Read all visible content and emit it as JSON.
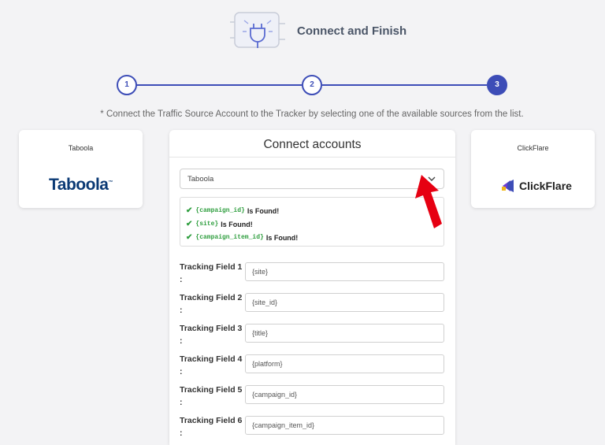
{
  "header": {
    "title": "Connect and Finish",
    "icon": "plug-icon"
  },
  "stepper": {
    "steps": [
      "1",
      "2",
      "3"
    ],
    "active": 3
  },
  "instruction": "* Connect the Traffic Source Account to the Tracker by selecting one of the available sources from the list.",
  "traffic_source": {
    "name": "Taboola",
    "logo_text": "Taboola"
  },
  "tracker": {
    "name": "ClickFlare",
    "logo_text": "ClickFlare"
  },
  "connect": {
    "title": "Connect accounts",
    "selected_source": "Taboola",
    "found": [
      {
        "token": "{campaign_id}",
        "text": "Is Found!"
      },
      {
        "token": "{site}",
        "text": "Is Found!"
      },
      {
        "token": "{campaign_item_id}",
        "text": "Is Found!"
      }
    ],
    "fields": [
      {
        "label": "Tracking Field 1 :",
        "value": "{site}"
      },
      {
        "label": "Tracking Field 2 :",
        "value": "{site_id}"
      },
      {
        "label": "Tracking Field 3 :",
        "value": "{title}"
      },
      {
        "label": "Tracking Field 4 :",
        "value": "{platform}"
      },
      {
        "label": "Tracking Field 5 :",
        "value": "{campaign_id}"
      },
      {
        "label": "Tracking Field 6 :",
        "value": "{campaign_item_id}"
      }
    ]
  },
  "colors": {
    "accent": "#3d4db7",
    "found": "#2e9e3e",
    "pointer": "#e60012"
  }
}
